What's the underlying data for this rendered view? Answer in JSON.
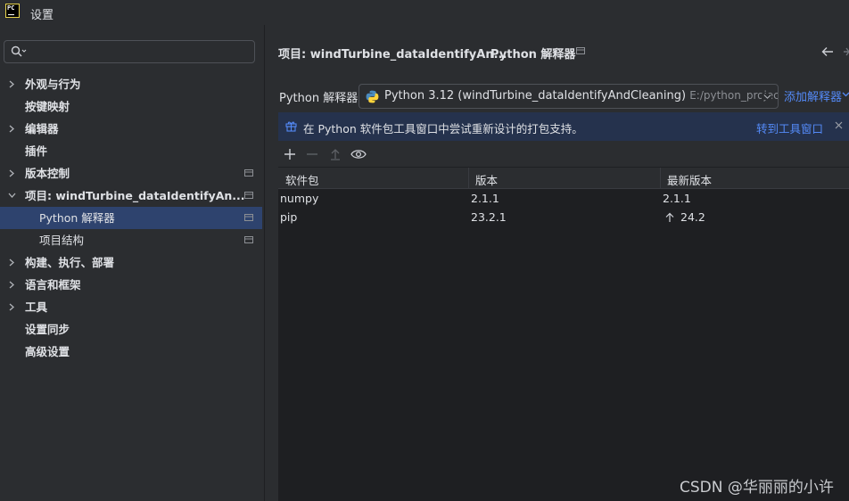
{
  "window": {
    "title": "设置",
    "logo_text": "PC"
  },
  "search": {
    "placeholder": "",
    "value": ""
  },
  "sidebar": {
    "items": [
      {
        "label": "外观与行为",
        "expandable": true
      },
      {
        "label": "按键映射",
        "expandable": false
      },
      {
        "label": "编辑器",
        "expandable": true
      },
      {
        "label": "插件",
        "expandable": false
      },
      {
        "label": "版本控制",
        "expandable": true
      },
      {
        "label": "项目: windTurbine_dataIdentifyAn...",
        "expandable": true,
        "expanded": true
      },
      {
        "label": "Python 解释器",
        "selected": true
      },
      {
        "label": "项目结构"
      },
      {
        "label": "构建、执行、部署",
        "expandable": true
      },
      {
        "label": "语言和框架",
        "expandable": true
      },
      {
        "label": "工具",
        "expandable": true
      },
      {
        "label": "设置同步",
        "expandable": false
      },
      {
        "label": "高级设置",
        "expandable": false
      }
    ]
  },
  "breadcrumb": {
    "item1": "项目: windTurbine_dataIdentifyAn...",
    "separator": "›",
    "item2": "Python 解释器"
  },
  "interpreter": {
    "label": "Python 解释器:",
    "value": "Python 3.12 (windTurbine_dataIdentifyAndCleaning)",
    "path": "E:/python_projects/wi",
    "add_label": "添加解释器"
  },
  "banner": {
    "text": "在 Python 软件包工具窗口中尝试重新设计的打包支持。",
    "link": "转到工具窗口"
  },
  "packages": {
    "columns": [
      "软件包",
      "版本",
      "最新版本"
    ],
    "rows": [
      {
        "name": "numpy",
        "version": "2.1.1",
        "latest": "2.1.1",
        "upgrade": false
      },
      {
        "name": "pip",
        "version": "23.2.1",
        "latest": "24.2",
        "upgrade": true
      }
    ]
  },
  "watermark": "CSDN @华丽丽的小许",
  "colors": {
    "background": "#2b2d30",
    "table_background": "#1e1f22",
    "selection": "#2e436e",
    "banner": "#25324d",
    "link": "#548af7"
  },
  "icons": [
    "app-logo-icon",
    "search-icon",
    "chevron-right-icon",
    "chevron-down-icon",
    "project-scope-icon",
    "python-icon",
    "gift-icon",
    "close-icon",
    "plus-icon",
    "minus-icon",
    "upgrade-icon",
    "eye-icon",
    "arrow-up-icon",
    "back-arrow-icon",
    "forward-arrow-icon"
  ]
}
